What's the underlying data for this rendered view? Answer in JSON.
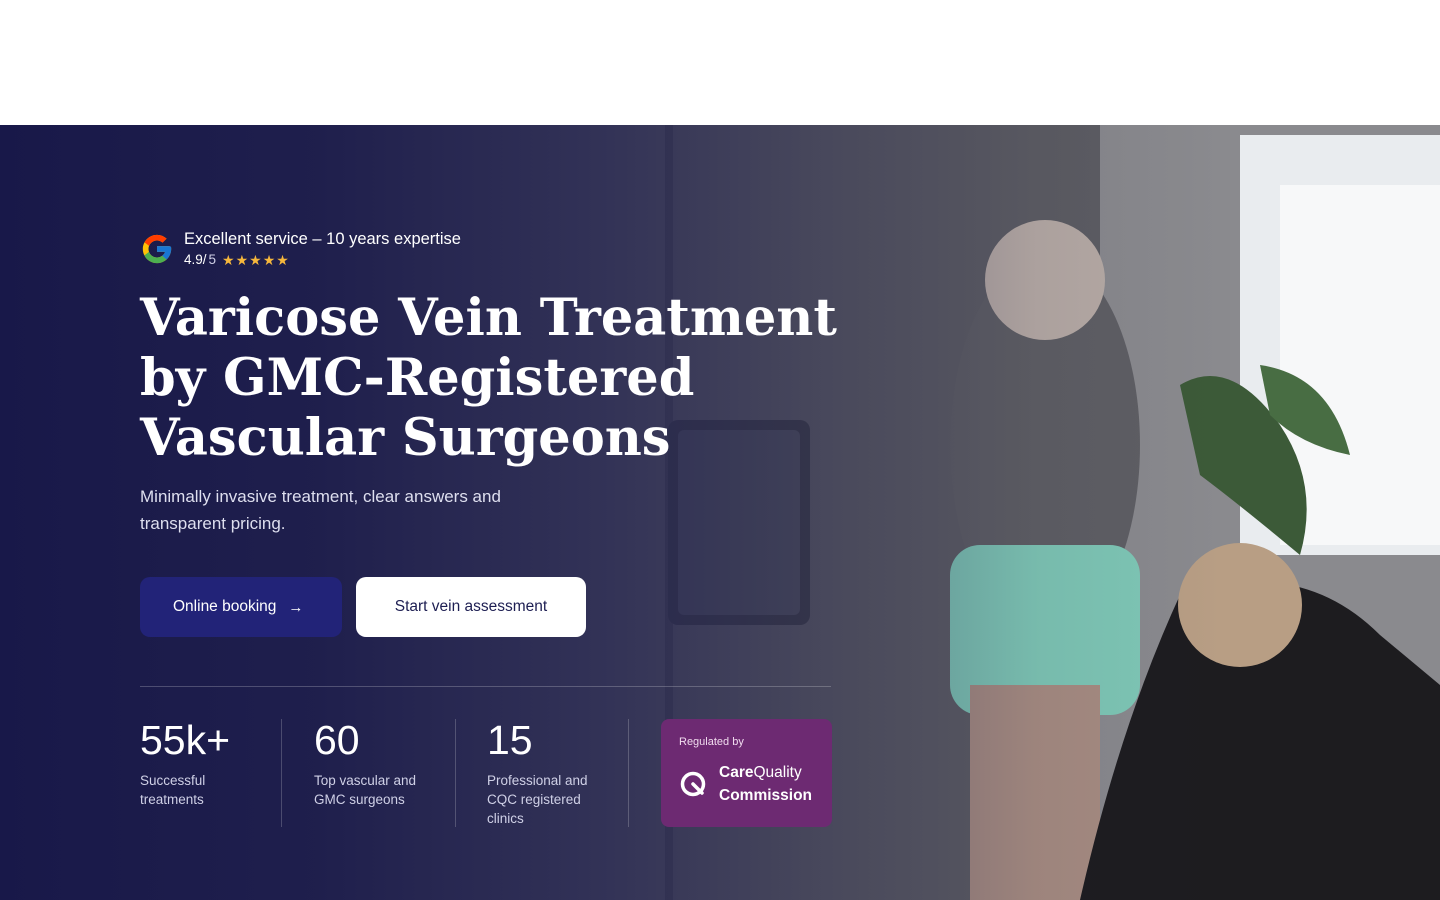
{
  "hero": {
    "rating": {
      "headline": "Excellent service – 10 years expertise",
      "score": "4.9/",
      "out_of": "5",
      "stars": "★★★★★"
    },
    "title_lines": [
      "Varicose Vein Treatment",
      "by GMC-Registered",
      "Vascular Surgeons"
    ],
    "subtitle": "Minimally invasive treatment, clear answers and transparent pricing.",
    "buttons": {
      "primary_label": "Online booking",
      "primary_icon": "arrow-right-icon",
      "secondary_label": "Start vein assessment"
    },
    "stats": [
      {
        "value": "55k+",
        "label": "Successful treatments"
      },
      {
        "value": "60",
        "label": "Top vascular and GMC surgeons"
      },
      {
        "value": "15",
        "label": "Professional and CQC registered clinics"
      }
    ],
    "regulator": {
      "regulated_by": "Regulated by",
      "name_part1": "Care",
      "name_part2": "Quality",
      "name_part3": "Commission"
    }
  },
  "colors": {
    "overlay": "#16164a",
    "primary_button": "#222378",
    "cqc_purple": "#6d2a72",
    "star": "#f6b73c"
  }
}
